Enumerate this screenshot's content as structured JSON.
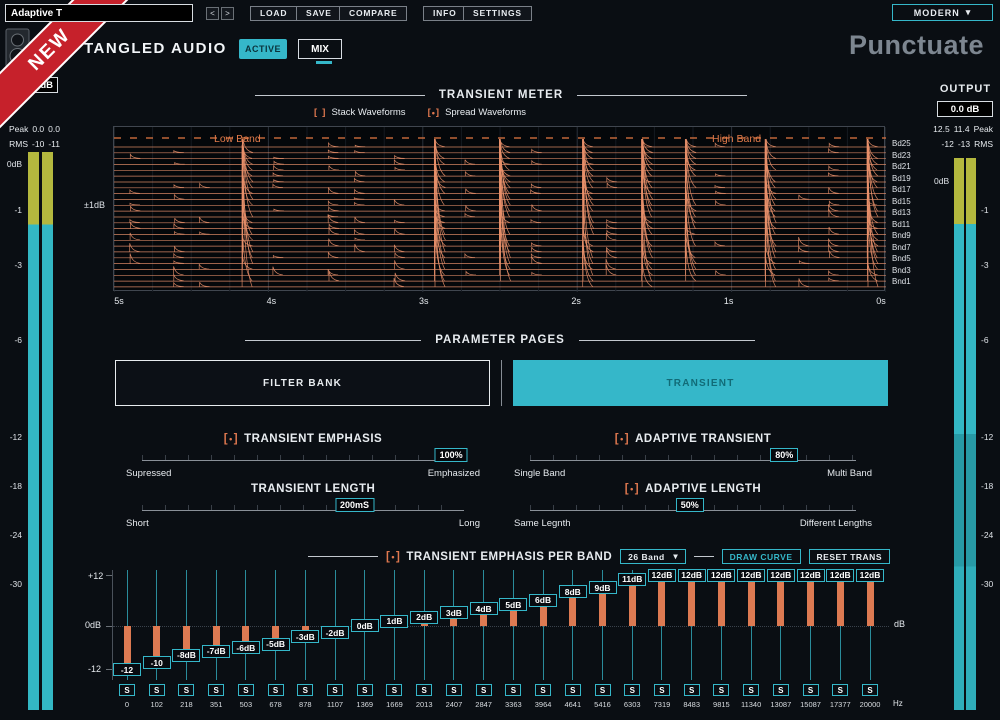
{
  "icons": {
    "chevron_down": "▾",
    "bracket_left": "[",
    "bracket_right": "]",
    "dot": "•",
    "prev": "<",
    "next": ">"
  },
  "top_bar": {
    "preset_name": "Adaptive T",
    "load_label": "LOAD",
    "save_label": "SAVE",
    "compare_label": "COMPARE",
    "info_label": "INFO",
    "settings_label": "SETTINGS",
    "skin_label": "MODERN"
  },
  "badge": {
    "label": "NEW",
    "color": "#c6212b"
  },
  "header": {
    "brand": "TANGLED AUDIO",
    "active_label": "ACTIVE",
    "mix_label": "MIX",
    "product": "Punctuate"
  },
  "input_meter": {
    "gain_value": "0.0 dB",
    "peak_label": "Peak",
    "peak_left": "0.0",
    "peak_right": "0.0",
    "rms_label": "RMS",
    "rms_left": "-10",
    "rms_right": "-11",
    "scale": [
      "0dB",
      "-1",
      "-3",
      "-6",
      "-12",
      "-18",
      "-24",
      "-30"
    ]
  },
  "output_meter": {
    "title": "OUTPUT",
    "gain_value": "0.0 dB",
    "peak_left": "12.5",
    "peak_right": "11.4",
    "peak_label": "Peak",
    "rms_left": "-12",
    "rms_right": "-13",
    "rms_label": "RMS",
    "zero_label": "0dB",
    "scale": [
      "-1",
      "-3",
      "-6",
      "-12",
      "-18",
      "-24",
      "-30"
    ]
  },
  "transient_meter": {
    "title": "TRANSIENT METER",
    "stack_label": "Stack Waveforms",
    "stack_checked": false,
    "spread_label": "Spread Waveforms",
    "spread_checked": true,
    "low_band_label": "Low Band",
    "high_band_label": "High Band",
    "amplitude_label": "±1dB",
    "band_labels": [
      "Bd25",
      "Bd23",
      "Bd21",
      "Bd19",
      "Bd17",
      "Bd15",
      "Bd13",
      "Bd11",
      "Bnd9",
      "Bnd7",
      "Bnd5",
      "Bnd3",
      "Bnd1"
    ],
    "time_labels": [
      "5s",
      "4s",
      "3s",
      "2s",
      "1s",
      "0s"
    ],
    "waveform_color": "#e8906a"
  },
  "parameter_pages": {
    "title": "PARAMETER PAGES",
    "filter_bank_label": "FILTER BANK",
    "transient_label": "TRANSIENT",
    "active_tab": "TRANSIENT"
  },
  "sliders": [
    {
      "title": "TRANSIENT EMPHASIS",
      "has_icon": true,
      "value": "100%",
      "position_pct": 96,
      "min_label": "Supressed",
      "max_label": "Emphasized"
    },
    {
      "title": "ADAPTIVE TRANSIENT",
      "has_icon": true,
      "value": "80%",
      "position_pct": 78,
      "min_label": "Single Band",
      "max_label": "Multi Band"
    },
    {
      "title": "TRANSIENT LENGTH",
      "has_icon": false,
      "value": "200mS",
      "position_pct": 66,
      "min_label": "Short",
      "max_label": "Long"
    },
    {
      "title": "ADAPTIVE LENGTH",
      "has_icon": true,
      "value": "50%",
      "position_pct": 49,
      "min_label": "Same Legnth",
      "max_label": "Different Lengths"
    }
  ],
  "per_band": {
    "title": "TRANSIENT EMPHASIS PER BAND",
    "band_count": "26 Band",
    "draw_curve_label": "DRAW CURVE",
    "reset_label": "RESET TRANS",
    "axis_top": "+12",
    "axis_mid": "0dB",
    "axis_bottom": "-12",
    "unit_label": "dB",
    "freq_unit_label": "Hz",
    "solo_label": "S",
    "values": [
      "-12",
      "-10",
      "-8dB",
      "-7dB",
      "-6dB",
      "-5dB",
      "-3dB",
      "-2dB",
      "0dB",
      "1dB",
      "2dB",
      "3dB",
      "4dB",
      "5dB",
      "6dB",
      "8dB",
      "9dB",
      "11dB",
      "12dB",
      "12dB",
      "12dB",
      "12dB",
      "12dB",
      "12dB",
      "12dB",
      "12dB"
    ],
    "values_db": [
      -12,
      -10,
      -8,
      -7,
      -6,
      -5,
      -3,
      -2,
      0,
      1,
      2,
      3,
      4,
      5,
      6,
      8,
      9,
      11,
      12,
      12,
      12,
      12,
      12,
      12,
      12,
      12
    ],
    "frequencies": [
      "0",
      "102",
      "218",
      "351",
      "503",
      "678",
      "878",
      "1107",
      "1369",
      "1669",
      "2013",
      "2407",
      "2847",
      "3363",
      "3964",
      "4641",
      "5416",
      "6303",
      "7319",
      "8483",
      "9815",
      "11340",
      "13087",
      "15087",
      "17377",
      "20000"
    ]
  },
  "colors": {
    "accent_teal": "#35b7c9",
    "accent_orange": "#e0784f",
    "meter_teal": "#33b7c4",
    "meter_yellow": "#b2b640",
    "badge_red": "#c6212b"
  }
}
